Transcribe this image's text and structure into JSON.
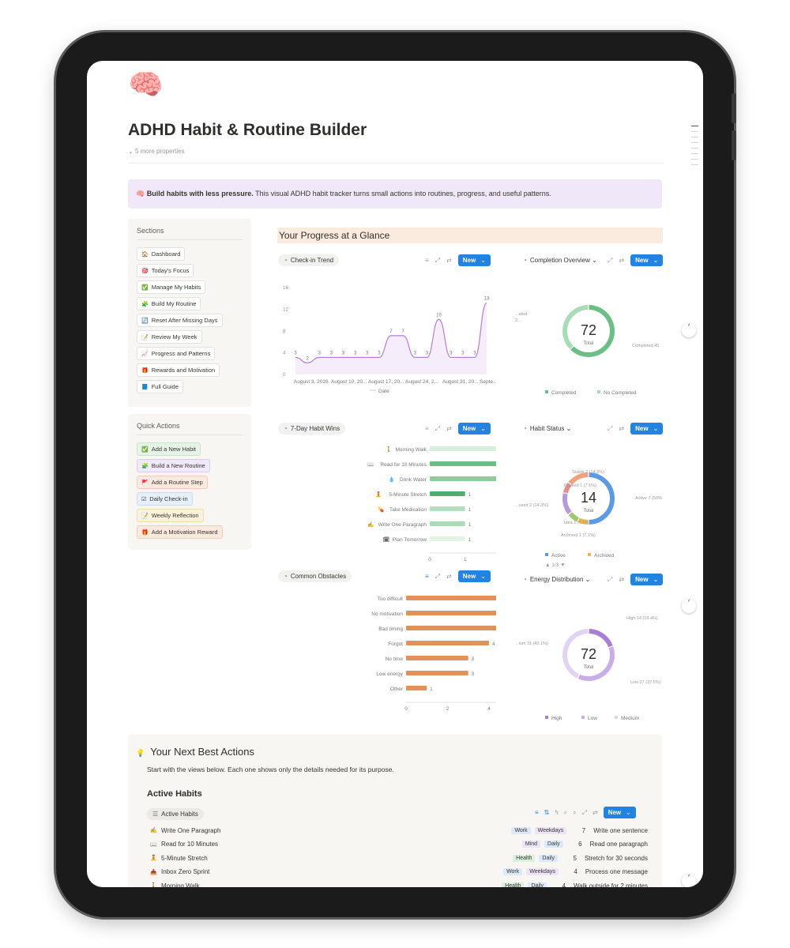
{
  "page": {
    "icon": "🧠",
    "title": "ADHD Habit & Routine Builder",
    "more_properties": "5 more properties"
  },
  "callout": {
    "icon": "🧠",
    "bold": "Build habits with less pressure.",
    "text": " This visual ADHD habit tracker turns small actions into routines, progress, and useful patterns."
  },
  "sections": {
    "title": "Sections",
    "items": [
      {
        "icon": "🏠",
        "label": "Dashboard"
      },
      {
        "icon": "🎯",
        "label": "Today's Focus"
      },
      {
        "icon": "✅",
        "label": "Manage My Habits"
      },
      {
        "icon": "🧩",
        "label": "Build My Routine"
      },
      {
        "icon": "🔄",
        "label": "Reset After Missing Days"
      },
      {
        "icon": "📝",
        "label": "Review My Week"
      },
      {
        "icon": "📈",
        "label": "Progress and Patterns"
      },
      {
        "icon": "🎁",
        "label": "Rewards and Motivation"
      },
      {
        "icon": "📘",
        "label": "Full Guide"
      }
    ]
  },
  "quick_actions": {
    "title": "Quick Actions",
    "items": [
      {
        "icon": "✅",
        "label": "Add a New Habit",
        "bg": "#e7f3e8",
        "border": "#c9e3cb"
      },
      {
        "icon": "🧩",
        "label": "Build a New Routine",
        "bg": "#f0e9f8",
        "border": "#dccdf0"
      },
      {
        "icon": "🚩",
        "label": "Add a Routine Step",
        "bg": "#fbe9df",
        "border": "#f1cdb9"
      },
      {
        "icon": "☑",
        "label": "Daily Check-in",
        "bg": "#e5f0fa",
        "border": "#c6dcf1"
      },
      {
        "icon": "📝",
        "label": "Weekly Reflection",
        "bg": "#faf2dc",
        "border": "#ecdcae"
      },
      {
        "icon": "🎁",
        "label": "Add a Motivation Reward",
        "bg": "#fbe9df",
        "border": "#f1cdb9"
      }
    ]
  },
  "progress_header": "Your Progress at a Glance",
  "widgets": {
    "checkin": {
      "label": "Check-in Trend",
      "new": "New"
    },
    "completion": {
      "label": "Completion Overview",
      "new": "New"
    },
    "wins": {
      "label": "7-Day Habit Wins",
      "new": "New"
    },
    "status": {
      "label": "Habit Status",
      "new": "New"
    },
    "obstacles": {
      "label": "Common Obstacles",
      "new": "New"
    },
    "energy": {
      "label": "Energy Distribution",
      "new": "New"
    }
  },
  "chart_data": [
    {
      "type": "line",
      "title": "Check-in Trend",
      "legend": [
        "Date"
      ],
      "ylim": [
        0,
        16
      ],
      "yticks": [
        0,
        4,
        8,
        12,
        16
      ],
      "xtick_labels": [
        "August 3, 2026",
        "August 10, 20...",
        "August 17, 20...",
        "August 24, 2...",
        "August 31, 20...",
        "Septe..."
      ],
      "point_labels": [
        "3",
        "2",
        "3",
        "3",
        "3",
        "3",
        "3",
        "3",
        "7",
        "7",
        "3",
        "3",
        "10",
        "3",
        "3",
        "3",
        "13"
      ],
      "values": [
        3,
        2,
        3,
        3,
        3,
        3,
        3,
        3,
        7,
        7,
        3,
        3,
        10,
        3,
        3,
        3,
        13
      ]
    },
    {
      "type": "pie",
      "title": "Completion Overview",
      "total": 72,
      "total_label": "Total",
      "slices": [
        {
          "name": "Completed",
          "value": 45,
          "color": "#6cbf84"
        },
        {
          "name": "No Completed",
          "value": 27,
          "color": "#a8dcb7"
        }
      ],
      "labels": [
        "Completed 45",
        "...ated",
        "2..."
      ],
      "legend": [
        "Completed",
        "No Completed"
      ]
    },
    {
      "type": "bar",
      "orientation": "horizontal",
      "title": "7-Day Habit Wins",
      "categories": [
        "Morning Walk",
        "Read for 10 Minutes",
        "Drink Water",
        "5-Minute Stretch",
        "Take Medication",
        "Write One Paragraph",
        "Plan Tomorrow"
      ],
      "icons": [
        "🚶",
        "📖",
        "💧",
        "🧘",
        "💊",
        "✍",
        "🗓"
      ],
      "values": [
        2,
        2,
        2,
        1,
        1,
        1,
        1
      ],
      "colors": [
        "#d7eedd",
        "#6cbf84",
        "#8ccd9d",
        "#4fae6b",
        "#b3dfc0",
        "#a8dcb7",
        "#e3f2e7"
      ],
      "xlim": [
        0,
        4
      ],
      "xticks": [
        0,
        1,
        2,
        3,
        4
      ]
    },
    {
      "type": "pie",
      "title": "Habit Status",
      "total": 14,
      "total_label": "Total",
      "slices": [
        {
          "name": "Active",
          "value": 7,
          "color": "#5b9ae6"
        },
        {
          "name": "Archived",
          "value": 1,
          "color": "#e8b84a"
        },
        {
          "name": "Idea",
          "value": 1,
          "color": "#9cc76f"
        },
        {
          "name": "Paused",
          "value": 2,
          "color": "#b49ad8"
        },
        {
          "name": "Paused",
          "value": 1,
          "color": "#e38e88"
        },
        {
          "name": "Stable",
          "value": 2,
          "color": "#f0a07a"
        }
      ],
      "labels": [
        "Stable 2 (14.3%)",
        "Paused 1 (7.1%)",
        "...used 2 (14.3%)",
        "Idea 1 (7.1%)",
        "Archived 1 (7.1%)",
        "Active 7 (50%"
      ],
      "legend": [
        "Active",
        "Archived"
      ],
      "pager": "1/3"
    },
    {
      "type": "bar",
      "orientation": "horizontal",
      "title": "Common Obstacles",
      "categories": [
        "Too difficult",
        "No motivation",
        "Bad timing",
        "Forgot",
        "No time",
        "Low energy",
        "Other"
      ],
      "values": [
        6,
        5,
        5,
        4,
        3,
        3,
        1
      ],
      "color": "#e0925a",
      "xlim": [
        0,
        8
      ],
      "xticks": [
        0,
        2,
        4,
        6,
        8
      ]
    },
    {
      "type": "pie",
      "title": "Energy Distribution",
      "total": 72,
      "total_label": "Total",
      "slices": [
        {
          "name": "High",
          "value": 14,
          "color": "#a77fd6"
        },
        {
          "name": "Low",
          "value": 27,
          "color": "#c8aee8"
        },
        {
          "name": "Medium",
          "value": 31,
          "color": "#e1d3f3"
        }
      ],
      "labels": [
        "High 14 (19.4%)",
        "Low 27 (37.5%)",
        "...ium 31 (43.1%)"
      ],
      "legend": [
        "High",
        "Low",
        "Medium"
      ]
    }
  ],
  "next_actions": {
    "icon": "💡",
    "title": "Your Next Best Actions",
    "subtitle": "Start with the views below. Each one shows only the details needed for its purpose.",
    "active_habits_title": "Active Habits",
    "view_tab": "Active Habits",
    "new": "New",
    "rows": [
      {
        "icon": "✍",
        "name": "Write One Paragraph",
        "area": "Work",
        "freq": "Weekdays",
        "num": "7",
        "step": "Write one sentence"
      },
      {
        "icon": "📖",
        "name": "Read for 10 Minutes",
        "area": "Mind",
        "freq": "Daily",
        "num": "6",
        "step": "Read one paragraph"
      },
      {
        "icon": "🧘",
        "name": "5-Minute Stretch",
        "area": "Health",
        "freq": "Daily",
        "num": "5",
        "step": "Stretch for 30 seconds"
      },
      {
        "icon": "📥",
        "name": "Inbox Zero Sprint",
        "area": "Work",
        "freq": "Weekdays",
        "num": "4",
        "step": "Process one message"
      },
      {
        "icon": "🚶",
        "name": "Morning Walk",
        "area": "Health",
        "freq": "Daily",
        "num": "4",
        "step": "Walk outside for 2 minutes"
      }
    ]
  },
  "tag_colors": {
    "Work": "#dbe8f7",
    "Mind": "#ece3f6",
    "Health": "#dcefe0",
    "Weekdays": "#ece3f6",
    "Daily": "#dbe8f7"
  }
}
